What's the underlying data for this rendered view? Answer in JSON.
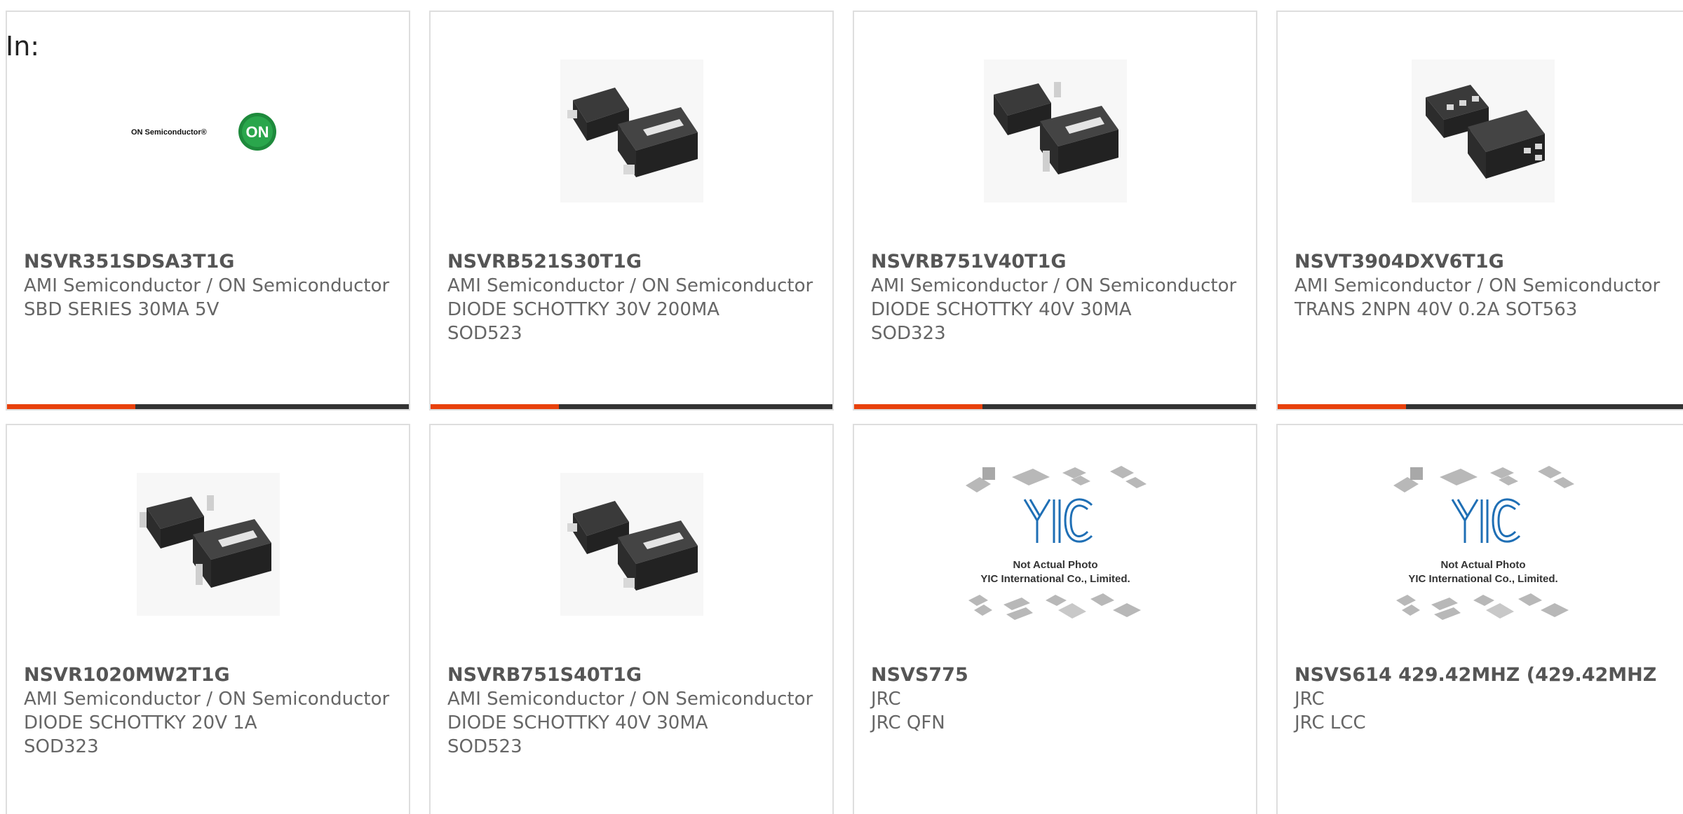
{
  "heading": "In:",
  "accent_color": "#e8410c",
  "products": [
    {
      "part": "NSVR351SDSA3T1G",
      "maker": "AMI Semiconductor / ON Semiconductor",
      "desc": "SBD SERIES 30MA 5V",
      "image": "on-semiconductor-logo",
      "logo_text": "ON Semiconductor®",
      "logo_badge": "ON"
    },
    {
      "part": "NSVRB521S30T1G",
      "maker": "AMI Semiconductor / ON Semiconductor",
      "desc": "DIODE SCHOTTKY 30V 200MA\nSOD523",
      "image": "sod523-diode-icon"
    },
    {
      "part": "NSVRB751V40T1G",
      "maker": "AMI Semiconductor / ON Semiconductor",
      "desc": "DIODE SCHOTTKY 40V 30MA\nSOD323",
      "image": "sod323-diode-icon"
    },
    {
      "part": "NSVT3904DXV6T1G",
      "maker": "AMI Semiconductor / ON Semiconductor",
      "desc": "TRANS 2NPN 40V 0.2A SOT563",
      "image": "sot563-transistor-icon"
    },
    {
      "part": "NSVR1020MW2T1G",
      "maker": "AMI Semiconductor / ON Semiconductor",
      "desc": "DIODE SCHOTTKY 20V 1A\nSOD323",
      "image": "sod323-diode-icon"
    },
    {
      "part": "NSVRB751S40T1G",
      "maker": "AMI Semiconductor / ON Semiconductor",
      "desc": "DIODE SCHOTTKY 40V 30MA\nSOD523",
      "image": "sod523-diode-icon"
    },
    {
      "part": "NSVS775",
      "maker": "JRC",
      "desc": "JRC QFN",
      "image": "yic-placeholder",
      "placeholder_line1": "Not Actual Photo",
      "placeholder_line2": "YIC International Co., Limited."
    },
    {
      "part": "NSVS614 429.42MHZ (429.42MHZ",
      "maker": "JRC",
      "desc": "JRC LCC",
      "image": "yic-placeholder",
      "placeholder_line1": "Not Actual Photo",
      "placeholder_line2": "YIC International Co., Limited."
    }
  ]
}
